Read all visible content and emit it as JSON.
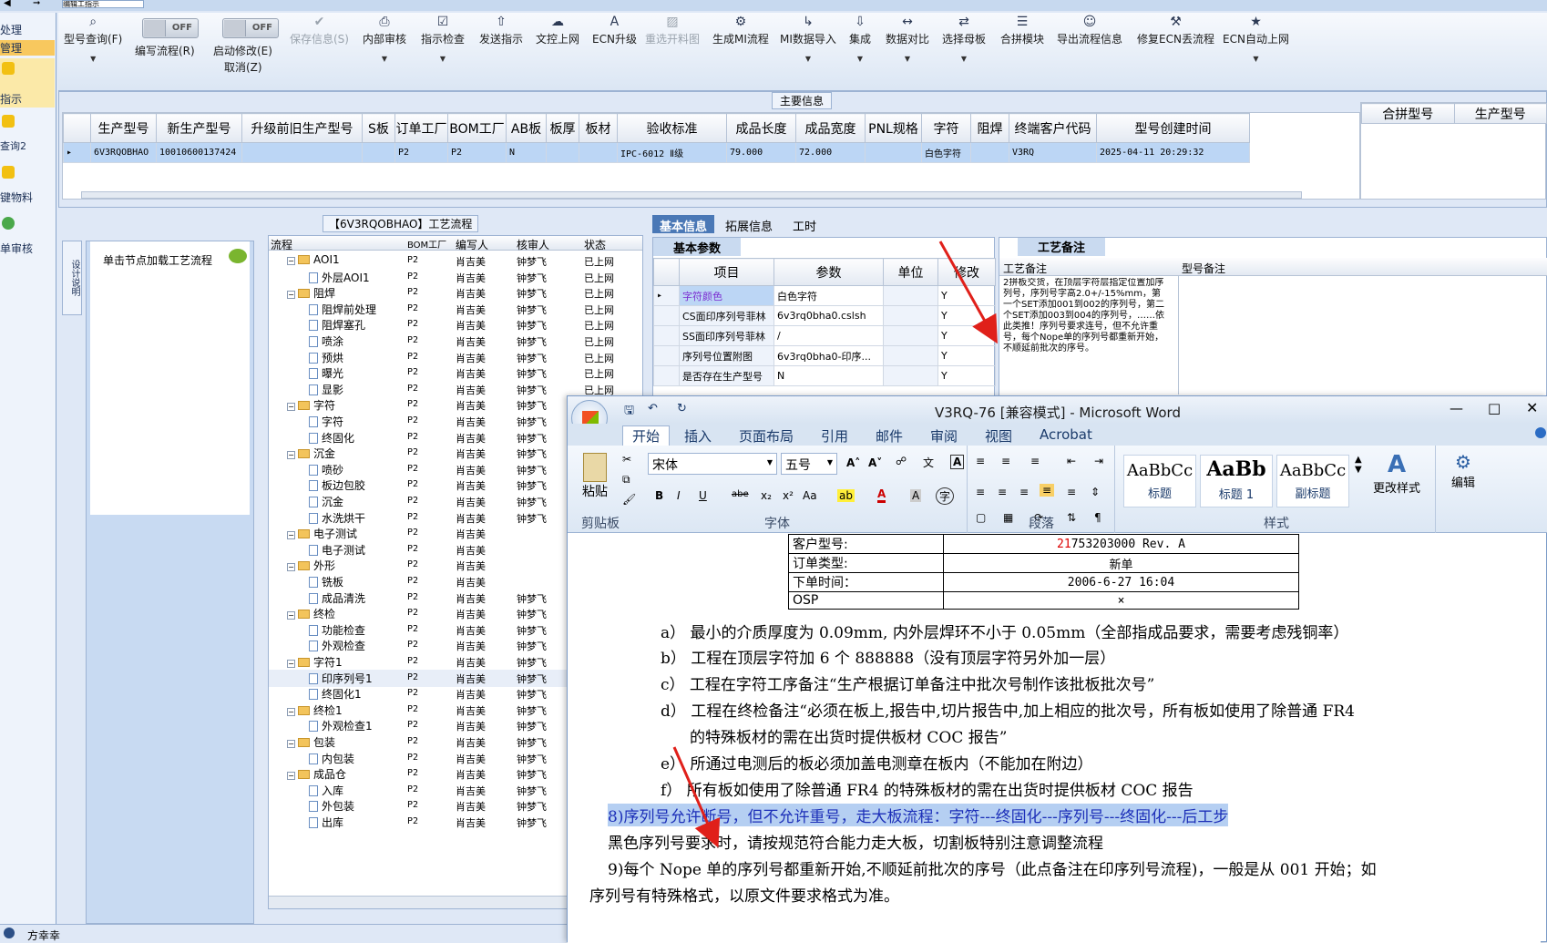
{
  "top_tab": "编辑工指示",
  "leftnav": [
    {
      "label": "处理",
      "icon": ""
    },
    {
      "label": "管理",
      "icon": ""
    },
    {
      "label": "指示",
      "icon": "lightning-icon"
    },
    {
      "label": "查询2",
      "icon": "folder-icon"
    },
    {
      "label": "键物料",
      "icon": "folder-icon"
    },
    {
      "label": "单审核",
      "icon": "user-icon"
    }
  ],
  "toolbar": {
    "items": [
      {
        "label": "型号查询(F)",
        "icon": "search-icon",
        "glyph": "⌕",
        "disabled": false,
        "dropdown": true
      },
      {
        "label": "保存信息(S)",
        "icon": "check-icon",
        "glyph": "✔",
        "disabled": true,
        "dropdown": false
      },
      {
        "label": "内部审核",
        "icon": "print-icon",
        "glyph": "⎙",
        "disabled": false,
        "dropdown": true
      },
      {
        "label": "指示检查",
        "icon": "checkbox-icon",
        "glyph": "☑",
        "disabled": false,
        "dropdown": true
      },
      {
        "label": "发送指示",
        "icon": "upload-icon",
        "glyph": "⇧",
        "disabled": false,
        "dropdown": false
      },
      {
        "label": "文控上网",
        "icon": "cloud-upload-icon",
        "glyph": "☁",
        "disabled": false,
        "dropdown": false
      },
      {
        "label": "ECN升级",
        "icon": "letter-a-icon",
        "glyph": "A",
        "disabled": false,
        "dropdown": false
      },
      {
        "label": "重选开料图",
        "icon": "image-icon",
        "glyph": "▨",
        "disabled": true,
        "dropdown": false
      },
      {
        "label": "生成MI流程",
        "icon": "gears-icon",
        "glyph": "⚙",
        "disabled": false,
        "dropdown": false
      },
      {
        "label": "MI数据导入",
        "icon": "import-icon",
        "glyph": "↳",
        "disabled": false,
        "dropdown": true
      },
      {
        "label": "集成",
        "icon": "download-icon",
        "glyph": "⇩",
        "disabled": false,
        "dropdown": true
      },
      {
        "label": "数据对比",
        "icon": "compare-icon",
        "glyph": "↔",
        "disabled": false,
        "dropdown": true
      },
      {
        "label": "选择母板",
        "icon": "shuffle-icon",
        "glyph": "⇄",
        "disabled": false,
        "dropdown": true
      },
      {
        "label": "合拼模块",
        "icon": "list-icon",
        "glyph": "☰",
        "disabled": false,
        "dropdown": false
      },
      {
        "label": "导出流程信息",
        "icon": "smiley-icon",
        "glyph": "☺",
        "disabled": false,
        "dropdown": false
      },
      {
        "label": "修复ECN丢流程",
        "icon": "wrench-icon",
        "glyph": "⚒",
        "disabled": false,
        "dropdown": false
      },
      {
        "label": "ECN自动上网",
        "icon": "star-icon",
        "glyph": "★",
        "disabled": false,
        "dropdown": true
      }
    ],
    "toggle1": {
      "label": "编写流程(R)",
      "state": "OFF"
    },
    "toggle2": {
      "label1": "启动修改(E)",
      "label2": "取消(Z)",
      "state": "OFF"
    }
  },
  "main_info": {
    "legend": "主要信息",
    "columns": [
      "生产型号",
      "新生产型号",
      "升级前旧生产型号",
      "S板",
      "订单工厂",
      "BOM工厂",
      "AB板",
      "板厚",
      "板材",
      "验收标准",
      "成品长度",
      "成品宽度",
      "PNL规格",
      "字符",
      "阻焊",
      "终端客户代码",
      "型号创建时间"
    ],
    "row": [
      "6V3RQOBHAO",
      "10010600137424",
      "",
      "",
      "P2",
      "P2",
      "N",
      "",
      "",
      "IPC-6012 Ⅱ级",
      "79.000",
      "72.000",
      "",
      "白色字符",
      "",
      "V3RQ",
      "2025-04-11 20:29:32"
    ],
    "side_columns": [
      "合拼型号",
      "生产型号"
    ]
  },
  "flow": {
    "title": "【6V3RQOBHAO】工艺流程",
    "side_tab": "设计说明",
    "hint": "单击节点加载工艺流程",
    "headers": [
      "流程",
      "BOM工厂",
      "编写人",
      "核审人",
      "状态"
    ],
    "rows": [
      {
        "level": 1,
        "type": "folder",
        "name": "AOI1",
        "bom": "P2",
        "writer": "肖吉美",
        "checker": "钟梦飞",
        "status": "已上网"
      },
      {
        "level": 2,
        "type": "doc",
        "name": "外层AOI1",
        "bom": "P2",
        "writer": "肖吉美",
        "checker": "钟梦飞",
        "status": "已上网"
      },
      {
        "level": 1,
        "type": "folder",
        "name": "阻焊",
        "bom": "P2",
        "writer": "肖吉美",
        "checker": "钟梦飞",
        "status": "已上网"
      },
      {
        "level": 2,
        "type": "doc",
        "name": "阻焊前处理",
        "bom": "P2",
        "writer": "肖吉美",
        "checker": "钟梦飞",
        "status": "已上网"
      },
      {
        "level": 2,
        "type": "doc",
        "name": "阻焊塞孔",
        "bom": "P2",
        "writer": "肖吉美",
        "checker": "钟梦飞",
        "status": "已上网"
      },
      {
        "level": 2,
        "type": "doc",
        "name": "喷涂",
        "bom": "P2",
        "writer": "肖吉美",
        "checker": "钟梦飞",
        "status": "已上网"
      },
      {
        "level": 2,
        "type": "doc",
        "name": "预烘",
        "bom": "P2",
        "writer": "肖吉美",
        "checker": "钟梦飞",
        "status": "已上网"
      },
      {
        "level": 2,
        "type": "doc",
        "name": "曝光",
        "bom": "P2",
        "writer": "肖吉美",
        "checker": "钟梦飞",
        "status": "已上网"
      },
      {
        "level": 2,
        "type": "doc",
        "name": "显影",
        "bom": "P2",
        "writer": "肖吉美",
        "checker": "钟梦飞",
        "status": "已上网"
      },
      {
        "level": 1,
        "type": "folder",
        "name": "字符",
        "bom": "P2",
        "writer": "肖吉美",
        "checker": "钟梦飞",
        "status": ""
      },
      {
        "level": 2,
        "type": "doc",
        "name": "字符",
        "bom": "P2",
        "writer": "肖吉美",
        "checker": "钟梦飞",
        "status": ""
      },
      {
        "level": 2,
        "type": "doc",
        "name": "终固化",
        "bom": "P2",
        "writer": "肖吉美",
        "checker": "钟梦飞",
        "status": ""
      },
      {
        "level": 1,
        "type": "folder",
        "name": "沉金",
        "bom": "P2",
        "writer": "肖吉美",
        "checker": "钟梦飞",
        "status": ""
      },
      {
        "level": 2,
        "type": "doc",
        "name": "喷砂",
        "bom": "P2",
        "writer": "肖吉美",
        "checker": "钟梦飞",
        "status": ""
      },
      {
        "level": 2,
        "type": "doc",
        "name": "板边包胶",
        "bom": "P2",
        "writer": "肖吉美",
        "checker": "钟梦飞",
        "status": ""
      },
      {
        "level": 2,
        "type": "doc",
        "name": "沉金",
        "bom": "P2",
        "writer": "肖吉美",
        "checker": "钟梦飞",
        "status": ""
      },
      {
        "level": 2,
        "type": "doc",
        "name": "水洗烘干",
        "bom": "P2",
        "writer": "肖吉美",
        "checker": "钟梦飞",
        "status": ""
      },
      {
        "level": 1,
        "type": "folder",
        "name": "电子测试",
        "bom": "P2",
        "writer": "肖吉美",
        "checker": "",
        "status": ""
      },
      {
        "level": 2,
        "type": "doc",
        "name": "电子测试",
        "bom": "P2",
        "writer": "肖吉美",
        "checker": "",
        "status": ""
      },
      {
        "level": 1,
        "type": "folder",
        "name": "外形",
        "bom": "P2",
        "writer": "肖吉美",
        "checker": "",
        "status": ""
      },
      {
        "level": 2,
        "type": "doc",
        "name": "铣板",
        "bom": "P2",
        "writer": "肖吉美",
        "checker": "",
        "status": ""
      },
      {
        "level": 2,
        "type": "doc",
        "name": "成品清洗",
        "bom": "P2",
        "writer": "肖吉美",
        "checker": "钟梦飞",
        "status": ""
      },
      {
        "level": 1,
        "type": "folder",
        "name": "终检",
        "bom": "P2",
        "writer": "肖吉美",
        "checker": "钟梦飞",
        "status": ""
      },
      {
        "level": 2,
        "type": "doc",
        "name": "功能检查",
        "bom": "P2",
        "writer": "肖吉美",
        "checker": "钟梦飞",
        "status": ""
      },
      {
        "level": 2,
        "type": "doc",
        "name": "外观检查",
        "bom": "P2",
        "writer": "肖吉美",
        "checker": "钟梦飞",
        "status": ""
      },
      {
        "level": 1,
        "type": "folder",
        "name": "字符1",
        "bom": "P2",
        "writer": "肖吉美",
        "checker": "钟梦飞",
        "status": ""
      },
      {
        "level": 2,
        "type": "doc",
        "name": "印序列号1",
        "bom": "P2",
        "writer": "肖吉美",
        "checker": "钟梦飞",
        "status": ""
      },
      {
        "level": 2,
        "type": "doc",
        "name": "终固化1",
        "bom": "P2",
        "writer": "肖吉美",
        "checker": "钟梦飞",
        "status": ""
      },
      {
        "level": 1,
        "type": "folder",
        "name": "终检1",
        "bom": "P2",
        "writer": "肖吉美",
        "checker": "钟梦飞",
        "status": ""
      },
      {
        "level": 2,
        "type": "doc",
        "name": "外观检查1",
        "bom": "P2",
        "writer": "肖吉美",
        "checker": "钟梦飞",
        "status": ""
      },
      {
        "level": 1,
        "type": "folder",
        "name": "包装",
        "bom": "P2",
        "writer": "肖吉美",
        "checker": "钟梦飞",
        "status": ""
      },
      {
        "level": 2,
        "type": "doc",
        "name": "内包装",
        "bom": "P2",
        "writer": "肖吉美",
        "checker": "钟梦飞",
        "status": ""
      },
      {
        "level": 1,
        "type": "folder",
        "name": "成品仓",
        "bom": "P2",
        "writer": "肖吉美",
        "checker": "钟梦飞",
        "status": ""
      },
      {
        "level": 2,
        "type": "doc",
        "name": "入库",
        "bom": "P2",
        "writer": "肖吉美",
        "checker": "钟梦飞",
        "status": ""
      },
      {
        "level": 2,
        "type": "doc",
        "name": "外包装",
        "bom": "P2",
        "writer": "肖吉美",
        "checker": "钟梦飞",
        "status": ""
      },
      {
        "level": 2,
        "type": "doc",
        "name": "出库",
        "bom": "P2",
        "writer": "肖吉美",
        "checker": "钟梦飞",
        "status": ""
      }
    ]
  },
  "tabs": {
    "items": [
      "基本信息",
      "拓展信息",
      "工时"
    ],
    "basic_title": "基本参数",
    "param_headers": [
      "项目",
      "参数",
      "单位",
      "修改"
    ],
    "params": [
      {
        "item": "字符颜色",
        "value": "白色字符",
        "unit": "",
        "edit": "Y"
      },
      {
        "item": "CS面印序列号菲林",
        "value": "6v3rq0bha0.cslsh",
        "unit": "",
        "edit": "Y"
      },
      {
        "item": "SS面印序列号菲林",
        "value": "/",
        "unit": "",
        "edit": "Y"
      },
      {
        "item": "序列号位置附图",
        "value": "6v3rq0bha0-印序...",
        "unit": "",
        "edit": "Y"
      },
      {
        "item": "是否存在生产型号",
        "value": "N",
        "unit": "",
        "edit": "Y"
      }
    ],
    "craft_tab": "工艺备注",
    "craft_headers": [
      "工艺备注",
      "型号备注"
    ],
    "craft_note": "2拼板交货，在顶层字符层指定位置加序列号，序列号字高2.0+/-15%mm，第一个SET添加001到002的序列号，第二个SET添加003到004的序列号，……依此类推！序列号要求连号，但不允许重号，每个Nope单的序列号都重新开始，不顺延前批次的序号。"
  },
  "statusbar": {
    "user": "方幸幸"
  },
  "word": {
    "title": "V3RQ-76 [兼容模式] - Microsoft Word",
    "tabs": [
      "开始",
      "插入",
      "页面布局",
      "引用",
      "邮件",
      "审阅",
      "视图",
      "Acrobat"
    ],
    "font_name": "宋体",
    "font_size": "五号",
    "groups": [
      "剪贴板",
      "字体",
      "段落",
      "样式"
    ],
    "paste": "粘贴",
    "styles": [
      {
        "sample": "AaBbCc",
        "name": "标题"
      },
      {
        "sample": "AaBb",
        "name": "标题 1"
      },
      {
        "sample": "AaBbCc",
        "name": "副标题"
      }
    ],
    "change_style": "更改样式",
    "edit": "编辑",
    "doc_table": [
      {
        "k": "客户型号:",
        "v_red": "21",
        "v": "753203000 Rev. A"
      },
      {
        "k": "订单类型:",
        "v_red": "",
        "v": "新单"
      },
      {
        "k": "下单时间：",
        "v_red": "",
        "v": "2006-6-27 16:04"
      },
      {
        "k": "OSP",
        "v_red": "",
        "v": "×"
      }
    ],
    "doc_lines": [
      "a） 最小的介质厚度为 0.09mm, 内外层焊环不小于 0.05mm（全部指成品要求，需要考虑残铜率）",
      "b） 工程在顶层字符加 6 个 888888（没有顶层字符另外加一层）",
      "c） 工程在字符工序备注“生产根据订单备注中批次号制作该批板批次号”",
      "d） 工程在终检备注“必须在板上,报告中,切片报告中,加上相应的批次号，所有板如使用了除普通 FR4",
      "的特殊板材的需在出货时提供板材 COC 报告”",
      "e） 所通过电测后的板必须加盖电测章在板内（不能加在附边）",
      "f） 所有板如使用了除普通 FR4 的特殊板材的需在出货时提供板材 COC 报告",
      "8)序列号允许断号，但不允许重号，走大板流程：字符---终固化---序列号---终固化---后工步",
      "黑色序列号要求时，请按规范符合能力走大板，切割板特别注意调整流程",
      "9)每个 Nope 单的序列号都重新开始,不顺延前批次的序号（此点备注在印序列号流程)，一般是从 001 开始；如",
      "序列号有特殊格式，以原文件要求格式为准。"
    ]
  }
}
